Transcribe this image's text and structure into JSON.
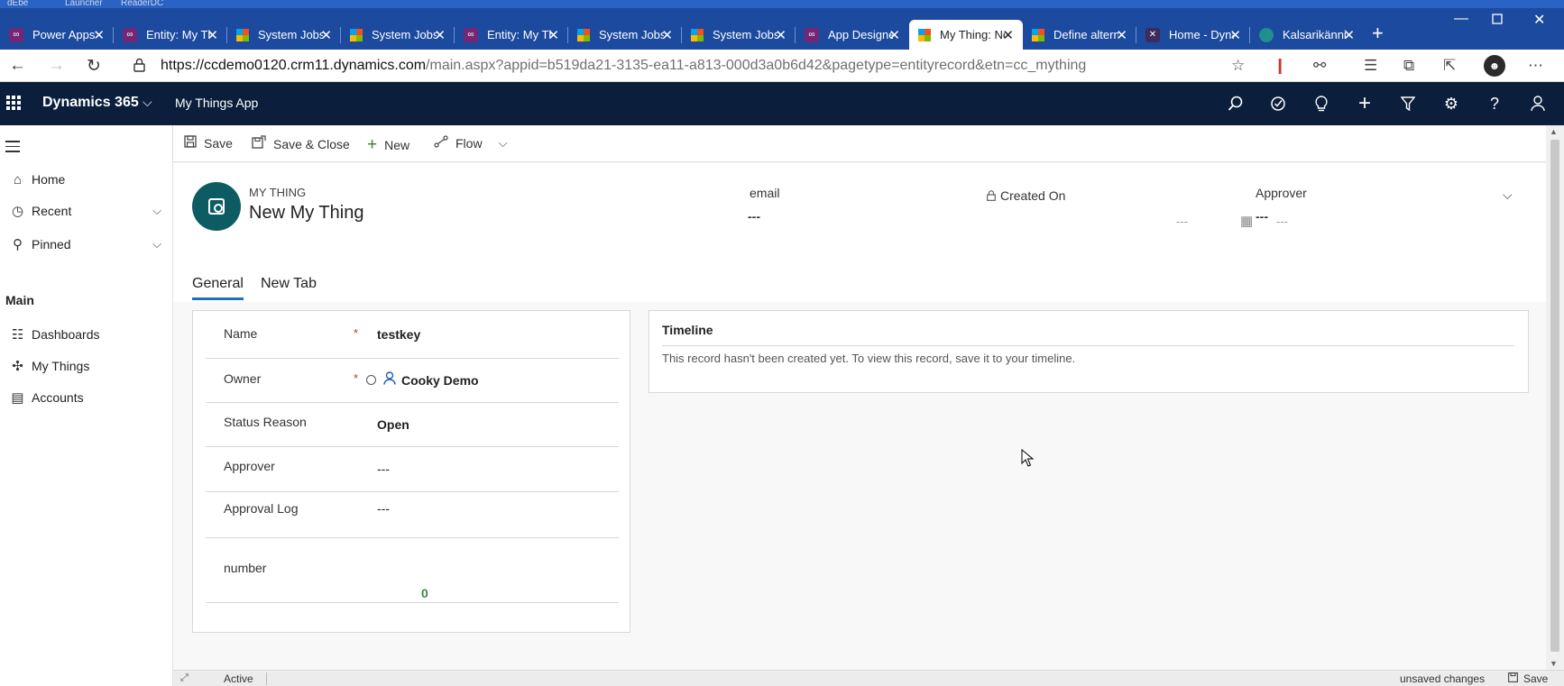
{
  "browser": {
    "taskbar_fragments": [
      "dEbe",
      "Launcher",
      "ReaderDC"
    ],
    "tabs": [
      {
        "title": "Power Apps",
        "icon": "power-apps-icon",
        "active": false
      },
      {
        "title": "Entity: My Things",
        "icon": "power-apps-icon",
        "active": false
      },
      {
        "title": "System Jobs",
        "icon": "microsoft-icon",
        "active": false
      },
      {
        "title": "System Jobs",
        "icon": "microsoft-icon",
        "active": false
      },
      {
        "title": "Entity: My Things",
        "icon": "power-apps-icon",
        "active": false
      },
      {
        "title": "System Jobs",
        "icon": "microsoft-icon",
        "active": false
      },
      {
        "title": "System Jobs",
        "icon": "microsoft-icon",
        "active": false
      },
      {
        "title": "App Designer",
        "icon": "power-apps-icon",
        "active": false
      },
      {
        "title": "My Thing: New",
        "icon": "microsoft-icon",
        "active": true
      },
      {
        "title": "Define alternate",
        "icon": "microsoft-icon",
        "active": false
      },
      {
        "title": "Home - Dynamics",
        "icon": "dynamics-icon",
        "active": false
      },
      {
        "title": "Kalsarikännit",
        "icon": "kalsarikannit-icon",
        "active": false
      }
    ],
    "url_host": "https://ccdemo0120.crm11.dynamics.com",
    "url_path": "/main.aspx?appid=b519da21-3135-ea11-a813-000d3a0b6d42&pagetype=entityrecord&etn=cc_mything"
  },
  "app_header": {
    "brand": "Dynamics 365",
    "app_name": "My Things App"
  },
  "sidebar": {
    "items": [
      {
        "label": "Home",
        "icon": "home-icon"
      },
      {
        "label": "Recent",
        "icon": "clock-icon"
      },
      {
        "label": "Pinned",
        "icon": "pin-icon"
      }
    ],
    "group_title": "Main",
    "group_items": [
      {
        "label": "Dashboards",
        "icon": "dashboard-icon"
      },
      {
        "label": "My Things",
        "icon": "puzzle-icon"
      },
      {
        "label": "Accounts",
        "icon": "building-icon"
      }
    ]
  },
  "command_bar": {
    "save": "Save",
    "save_close": "Save & Close",
    "new": "New",
    "flow": "Flow"
  },
  "record_header": {
    "entity_label": "MY THING",
    "title": "New My Thing",
    "fields": {
      "email_label": "email",
      "email_value": "---",
      "created_on_label": "Created On",
      "created_on_date": "---",
      "created_on_time": "---",
      "approver_label": "Approver",
      "approver_value": "---"
    }
  },
  "form_tabs": [
    "General",
    "New Tab"
  ],
  "form_fields": {
    "name_label": "Name",
    "name_value": "testkey",
    "owner_label": "Owner",
    "owner_value": "Cooky Demo",
    "status_label": "Status Reason",
    "status_value": "Open",
    "approver_label": "Approver",
    "approver_value": "---",
    "approval_log_label": "Approval Log",
    "approval_log_value": "---",
    "number_label": "number",
    "number_value": "0",
    "required_marker": "*"
  },
  "timeline": {
    "title": "Timeline",
    "message": "This record hasn't been created yet.  To view this record, save it to your timeline."
  },
  "status_bar": {
    "record_status": "Active",
    "unsaved": "unsaved changes",
    "save": "Save"
  },
  "colors": {
    "browser_tabbar": "#1c4a9e",
    "app_header": "#0b1e3b",
    "avatar": "#0d5c63",
    "link": "#1f5fb0",
    "active_tab_underline": "#1f6fbf",
    "required": "#c0392b",
    "number_value": "#3a8a3a"
  }
}
